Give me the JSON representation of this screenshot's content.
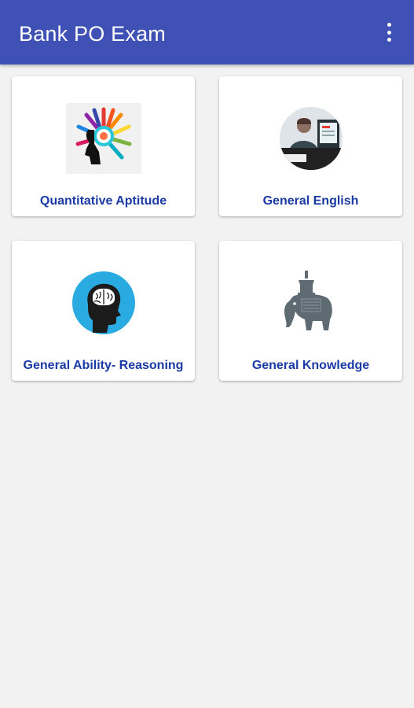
{
  "app_bar": {
    "title": "Bank PO Exam",
    "background_color": "#3f51b5",
    "overflow_icon": "more-vert-icon"
  },
  "cards": [
    {
      "label": "Quantitative Aptitude",
      "icon": "colorful-head-icon"
    },
    {
      "label": "General English",
      "icon": "person-at-computer-icon"
    },
    {
      "label": "General Ability- Reasoning",
      "icon": "brain-head-icon"
    },
    {
      "label": "General Knowledge",
      "icon": "elephant-icon"
    }
  ],
  "colors": {
    "label_text": "#1a3aa5",
    "page_background": "#f2f2f2",
    "card_background": "#ffffff"
  }
}
